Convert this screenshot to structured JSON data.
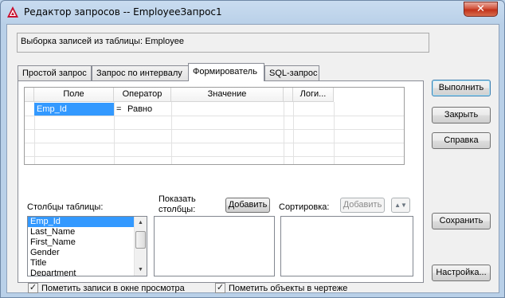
{
  "window": {
    "title": "Редактор запросов -- EmployeeЗапрос1",
    "close_glyph": "✕"
  },
  "info": {
    "text": "Выборка записей из таблицы:  Employee"
  },
  "tabs": [
    {
      "label": "Простой запрос"
    },
    {
      "label": "Запрос по интервалу"
    },
    {
      "label": "Формирователь"
    },
    {
      "label": "SQL-запрос"
    }
  ],
  "active_tab": "Формирователь",
  "grid": {
    "columns": [
      "Поле",
      "Оператор",
      "Значение",
      "Логи..."
    ],
    "rows": [
      {
        "field": "Emp_Id",
        "op_symbol": "=",
        "operator": "Равно",
        "value": "",
        "logic": ""
      }
    ]
  },
  "columns_section": {
    "label": "Столбцы таблицы:",
    "items": [
      "Emp_Id",
      "Last_Name",
      "First_Name",
      "Gender",
      "Title",
      "Department"
    ],
    "selected": "Emp_Id"
  },
  "show_section": {
    "label_line1": "Показать",
    "label_line2": "столбцы:",
    "add_label": "Добавить"
  },
  "sort_section": {
    "label": "Сортировка:",
    "add_label": "Добавить",
    "toggle_glyph": "▲▼"
  },
  "checkboxes": {
    "mark_preview": {
      "label": "Пометить записи в окне просмотра",
      "checked": true
    },
    "mark_drawing": {
      "label": "Пометить объекты в чертеже",
      "checked": true
    }
  },
  "buttons": {
    "execute": "Выполнить",
    "close": "Закрыть",
    "help": "Справка",
    "save": "Сохранить",
    "settings": "Настройка..."
  },
  "colors": {
    "selection": "#3399ff",
    "title_bar": "#b9d0e8",
    "close_button": "#c1321a"
  }
}
